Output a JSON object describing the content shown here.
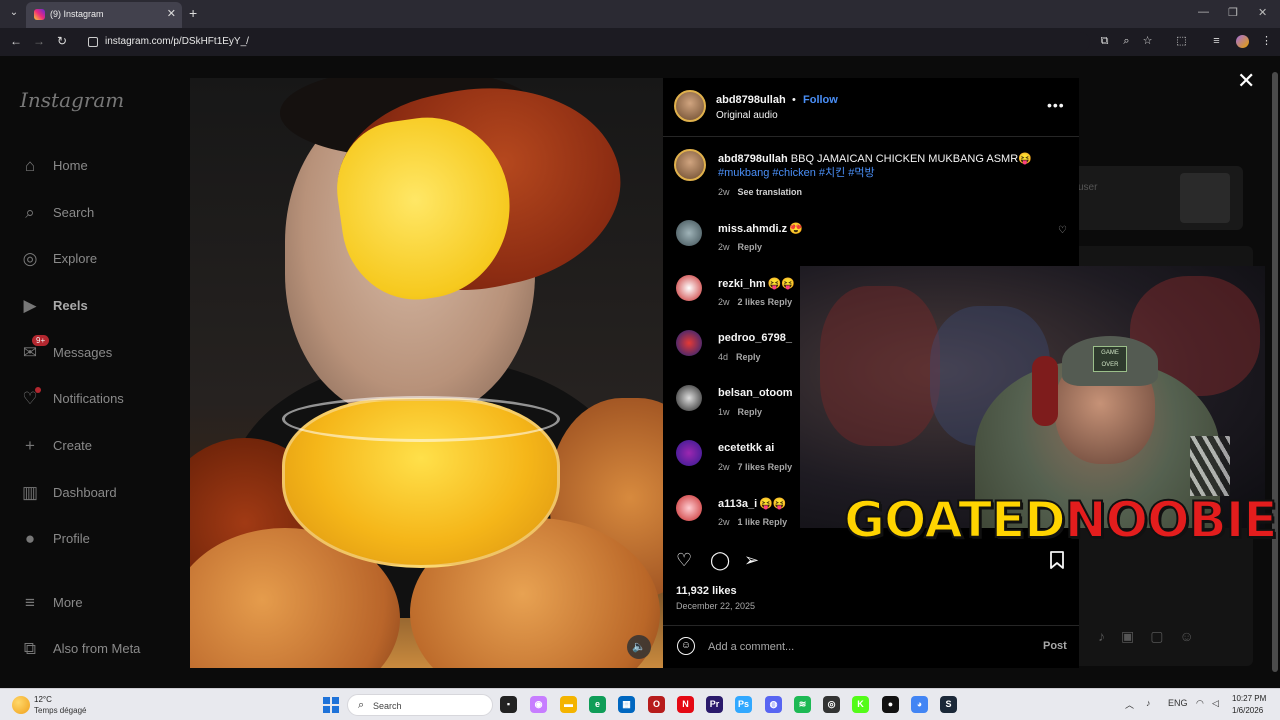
{
  "browser": {
    "tab_title": "(9) Instagram",
    "url": "instagram.com/p/DSkHFt1EyY_/"
  },
  "sidebar": {
    "logo": "Instagram",
    "items": [
      {
        "label": "Home",
        "icon": "home-icon"
      },
      {
        "label": "Search",
        "icon": "search-icon"
      },
      {
        "label": "Explore",
        "icon": "compass-icon"
      },
      {
        "label": "Reels",
        "icon": "reels-icon"
      },
      {
        "label": "Messages",
        "icon": "messenger-icon",
        "badge": "9+"
      },
      {
        "label": "Notifications",
        "icon": "heart-icon"
      },
      {
        "label": "Create",
        "icon": "plus-icon"
      },
      {
        "label": "Dashboard",
        "icon": "dashboard-icon"
      },
      {
        "label": "Profile",
        "icon": "avatar-icon"
      },
      {
        "label": "More",
        "icon": "menu-icon"
      },
      {
        "label": "Also from Meta",
        "icon": "meta-icon"
      }
    ]
  },
  "background_panel": {
    "user_text": "user"
  },
  "post": {
    "author": "abd8798ullah",
    "separator": "•",
    "follow_label": "Follow",
    "audio": "Original audio",
    "caption": "BBQ JAMAICAN CHICKEN MUKBANG ASMR😝",
    "hashtags": "#mukbang #chicken #치킨 #먹방",
    "caption_age": "2w",
    "see_translation": "See translation",
    "likes": "11,932 likes",
    "date": "December 22, 2025",
    "comment_placeholder": "Add a comment...",
    "post_label": "Post"
  },
  "comments": [
    {
      "user": "miss.ahmdi.z",
      "text": "😍",
      "age": "2w",
      "likes": "",
      "reply": "Reply"
    },
    {
      "user": "rezki_hm",
      "text": "😝😝",
      "age": "2w",
      "likes": "2 likes",
      "reply": "Reply"
    },
    {
      "user": "pedroo_6798_",
      "text": "",
      "age": "4d",
      "likes": "",
      "reply": "Reply"
    },
    {
      "user": "belsan_otoom",
      "text": "",
      "age": "1w",
      "likes": "",
      "reply": "Reply"
    },
    {
      "user": "ecetetkk ai",
      "text": "",
      "age": "2w",
      "likes": "7 likes",
      "reply": "Reply"
    },
    {
      "user": "a113a_i",
      "text": "😝😝",
      "age": "2w",
      "likes": "1 like",
      "reply": "Reply"
    }
  ],
  "stream_overlay": {
    "logo_part1": "GOATED",
    "logo_part2": "NOOBIE",
    "cap_patch": "GAME OVER"
  },
  "taskbar": {
    "temperature": "12°C",
    "weather": "Temps dégagé",
    "search_placeholder": "Search",
    "language": "ENG",
    "time": "10:27 PM",
    "date": "1/6/2026"
  },
  "colors": {
    "accent_blue": "#4a8ff7",
    "logo_yellow": "#ffd400",
    "logo_red": "#e31d1d"
  }
}
